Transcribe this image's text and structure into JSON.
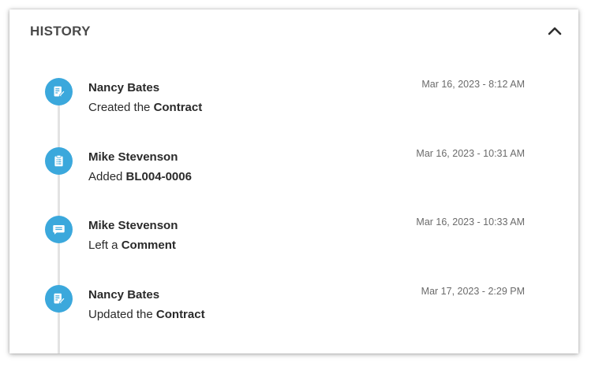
{
  "panel": {
    "title": "HISTORY",
    "collapse_icon": "chevron-up-icon",
    "accent_color": "#3ba8dc"
  },
  "history": [
    {
      "icon": "edit-document-icon",
      "user": "Nancy Bates",
      "action_prefix": "Created the ",
      "action_object": "Contract",
      "timestamp": "Mar 16, 2023 - 8:12 AM"
    },
    {
      "icon": "clipboard-icon",
      "user": "Mike Stevenson",
      "action_prefix": "Added ",
      "action_object": "BL004-0006",
      "timestamp": "Mar 16, 2023 - 10:31 AM"
    },
    {
      "icon": "comment-icon",
      "user": "Mike Stevenson",
      "action_prefix": "Left a ",
      "action_object": "Comment",
      "timestamp": "Mar 16, 2023 - 10:33 AM"
    },
    {
      "icon": "edit-document-icon",
      "user": "Nancy Bates",
      "action_prefix": "Updated the ",
      "action_object": "Contract",
      "timestamp": "Mar 17, 2023 - 2:29 PM"
    }
  ]
}
